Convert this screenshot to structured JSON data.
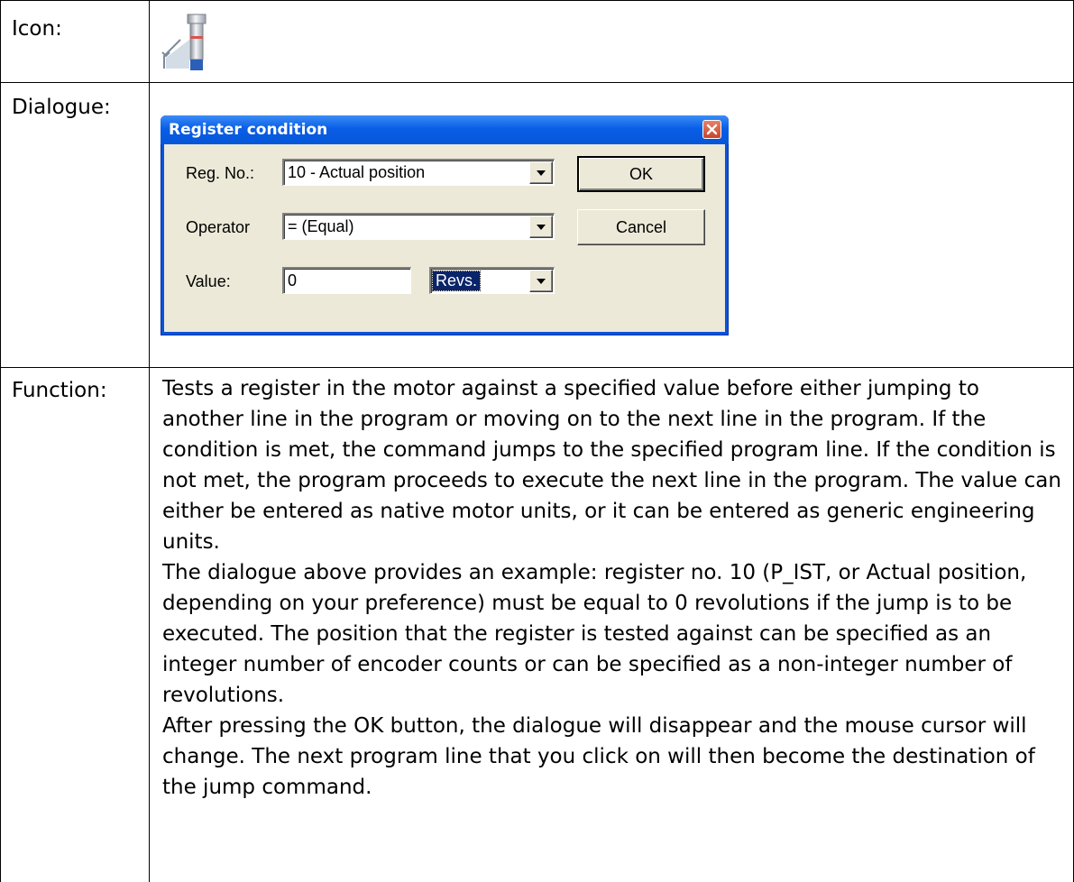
{
  "rows": {
    "icon_label": "Icon:",
    "dialogue_label": "Dialogue:",
    "function_label": "Function:"
  },
  "icon": {
    "name": "register-condition-icon"
  },
  "dialog": {
    "title": "Register condition",
    "reg_no_label": "Reg. No.:",
    "reg_no_value": "10 - Actual position",
    "operator_label": "Operator",
    "operator_value": "= (Equal)",
    "value_label": "Value:",
    "value_value": "0",
    "unit_value": "Revs.",
    "ok_label": "OK",
    "cancel_label": "Cancel",
    "close_icon": "close-icon",
    "colors": {
      "titlebar": "#0a5ee6",
      "body": "#ece9d8",
      "close": "#c8452b"
    }
  },
  "function": {
    "paragraphs": [
      "Tests a register in the motor against a specified value before either jumping to another line in the program or moving on to the next line in the program. If the condition is met, the command jumps to the specified program line. If the condition is not met, the program proceeds to execute the next line in the program. The value can either be entered as native motor units, or it can be entered as generic engineering units.",
      "The dialogue above provides an example: register no. 10 (P_IST, or Actual position, depending on your preference) must be equal to 0 revolutions if the jump is to be executed. The position that the register is tested against can be specified as an integer number of encoder counts or can be specified as a non-integer number of revolutions.",
      "After pressing the OK button, the dialogue will disappear and the mouse cursor will change. The next program line that you click on will then become the destination of the jump command."
    ]
  }
}
